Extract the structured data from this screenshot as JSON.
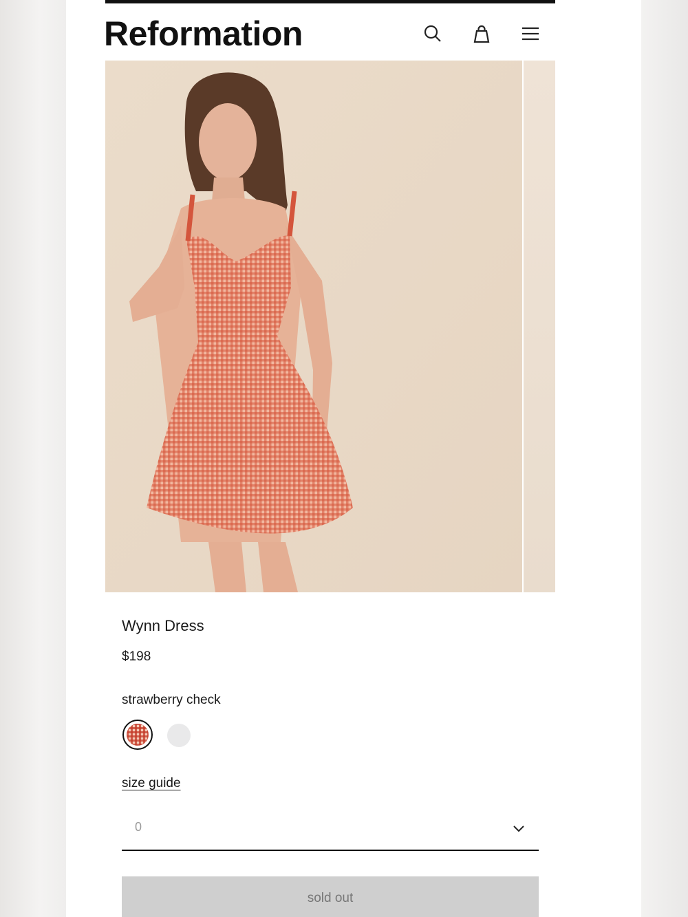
{
  "header": {
    "logo_text": "Reformation",
    "icons": [
      "search-icon",
      "shopping-bag-icon",
      "hamburger-menu-icon"
    ]
  },
  "product": {
    "name": "Wynn Dress",
    "price": "$198",
    "color_label": "strawberry check",
    "swatches": [
      {
        "name": "strawberry check",
        "selected": true,
        "color": "#d9573d"
      },
      {
        "name": "",
        "selected": false,
        "color": "#e9e9ea"
      }
    ],
    "size_guide_label": "size guide",
    "size_select": {
      "value": "0"
    },
    "cta_label": "sold out"
  },
  "colors": {
    "background": "#ffffff",
    "text": "#1a1a1a",
    "button_disabled": "#cfcfcf",
    "button_disabled_text": "#777777"
  }
}
